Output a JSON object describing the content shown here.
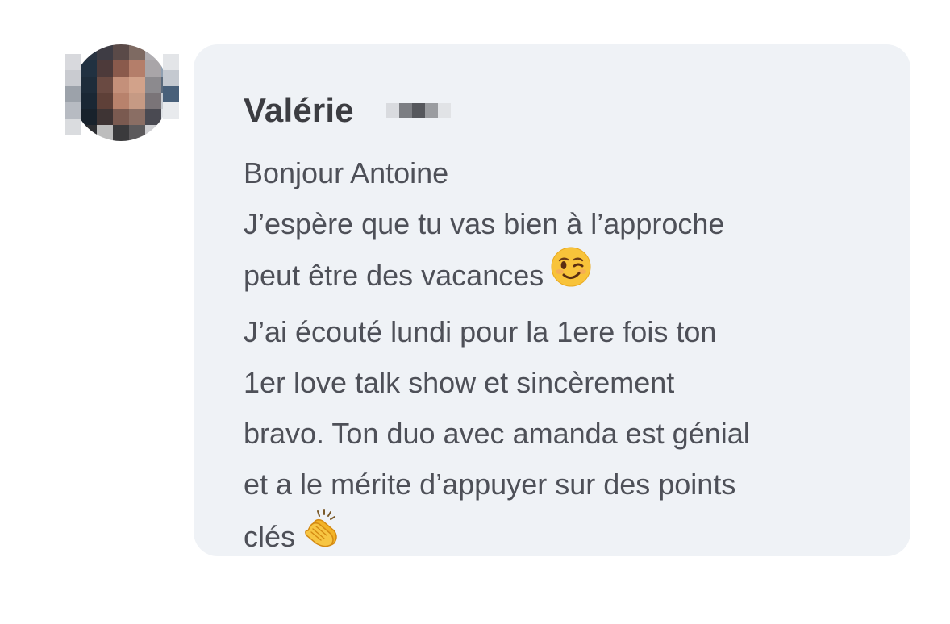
{
  "message": {
    "sender": "Valérie",
    "lines": [
      "Bonjour Antoine",
      "J’espère que tu vas bien à l’approche",
      "peut être des vacances",
      "J’ai écouté lundi pour la 1ere fois ton",
      "1er love talk show et sincèrement",
      "bravo. Ton duo avec amanda est génial",
      "et a le mérite d’appuyer sur des points",
      "clés"
    ],
    "emojis": {
      "line_3": "winking-face",
      "line_8": "clapping-hands"
    }
  },
  "colors": {
    "bubble_background": "#eff2f6",
    "sender_text": "#3c3d42",
    "message_text": "#4e5058"
  }
}
